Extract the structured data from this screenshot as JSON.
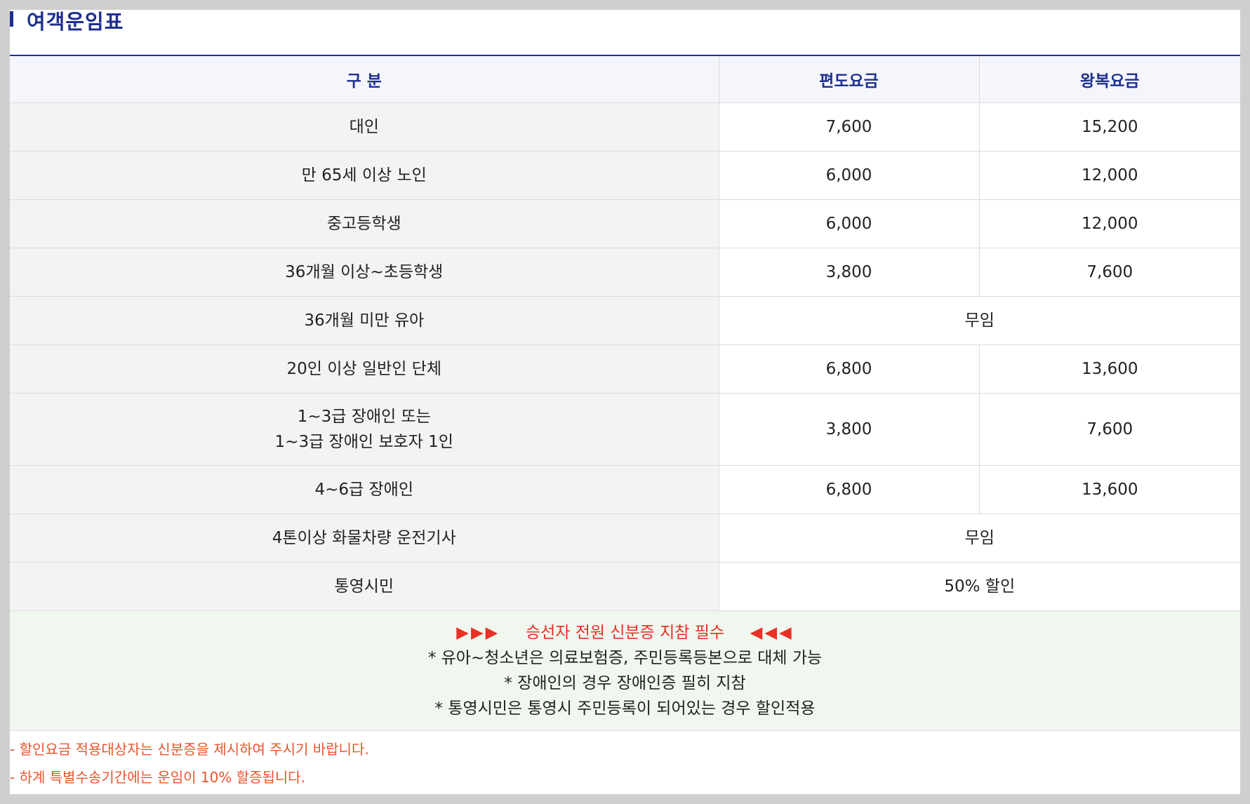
{
  "title": "여객운임표",
  "table": {
    "headers": [
      "구 분",
      "편도요금",
      "왕복요금"
    ],
    "rows": [
      {
        "category": "대인",
        "oneway": "7,600",
        "roundtrip": "15,200"
      },
      {
        "category": "만 65세 이상 노인",
        "oneway": "6,000",
        "roundtrip": "12,000"
      },
      {
        "category": "중고등학생",
        "oneway": "6,000",
        "roundtrip": "12,000"
      },
      {
        "category": "36개월 이상~초등학생",
        "oneway": "3,800",
        "roundtrip": "7,600"
      },
      {
        "category": "36개월 미만 유아",
        "merged": "무임"
      },
      {
        "category": "20인 이상 일반인 단체",
        "oneway": "6,800",
        "roundtrip": "13,600"
      },
      {
        "category_line1": "1~3급 장애인 또는",
        "category_line2": "1~3급 장애인 보호자 1인",
        "oneway": "3,800",
        "roundtrip": "7,600"
      },
      {
        "category": "4~6급 장애인",
        "oneway": "6,800",
        "roundtrip": "13,600"
      },
      {
        "category": "4톤이상 화물차량 운전기사",
        "merged": "무임"
      },
      {
        "category": "통영시민",
        "merged": "50% 할인"
      }
    ]
  },
  "notice": {
    "left_arrows": "▶▶▶",
    "heading": "승선자 전원 신분증 지참 필수",
    "right_arrows": "◀◀◀",
    "lines": [
      "* 유아~청소년은 의료보험증, 주민등록등본으로 대체 가능",
      "* 장애인의 경우 장애인증 필히 지참",
      "* 통영시민은 통영시 주민등록이 되어있는 경우 할인적용"
    ]
  },
  "footnotes": [
    "- 할인요금 적용대상자는 신분증을 제시하여 주시기 바랍니다.",
    "- 하계 특별수송기간에는 운임이 10% 할증됩니다."
  ],
  "colors": {
    "title": "#1e2f8f",
    "notice_heading": "#e83025",
    "footnote": "#e8542c",
    "notice_bg": "#f0f7ef"
  }
}
